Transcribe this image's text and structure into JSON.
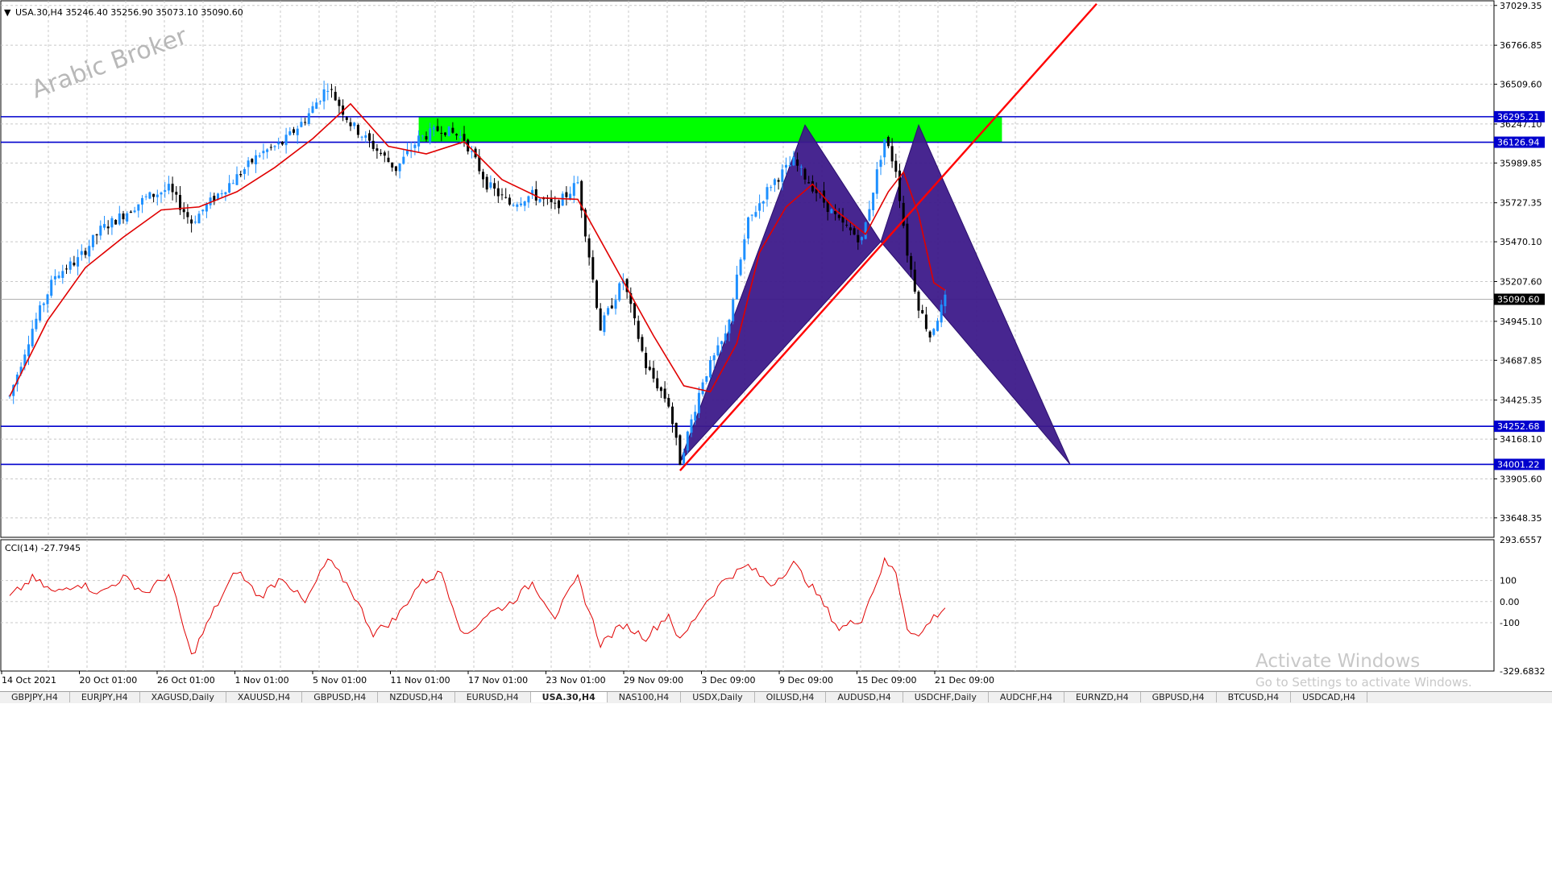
{
  "header": {
    "symbol_info": "USA.30,H4  35246.40 35256.90 35073.10 35090.60",
    "menu_icon": "triangle-down-icon"
  },
  "watermark": "Arabic Broker",
  "price_axis": {
    "ticks": [
      37029.35,
      36766.85,
      36509.6,
      36247.1,
      35989.85,
      35727.35,
      35470.1,
      35207.6,
      34945.1,
      34687.85,
      34425.35,
      34168.1,
      33905.6,
      33648.35
    ],
    "current_price": "35090.60"
  },
  "levels": [
    {
      "value": 36295.21,
      "label": "36295.21"
    },
    {
      "value": 36126.94,
      "label": "36126.94"
    },
    {
      "value": 34252.68,
      "label": "34252.68"
    },
    {
      "value": 34001.22,
      "label": "34001.22"
    }
  ],
  "colors": {
    "level_line": "#0000cd",
    "zone": "#00ff00",
    "pattern": "#3d1a8a",
    "trend": "#ff0000",
    "ma": "#e00000",
    "candle_up": "#1e90ff",
    "candle_down": "#000000",
    "cci": "#e00000"
  },
  "cci": {
    "label": "CCI(14) -27.7945",
    "ticks": [
      "293.6557",
      "100",
      "0.00",
      "-100",
      "-329.6832"
    ]
  },
  "time_axis": {
    "labels": [
      "14 Oct 2021",
      "20 Oct 01:00",
      "26 Oct 01:00",
      "1 Nov 01:00",
      "5 Nov 01:00",
      "11 Nov 01:00",
      "17 Nov 01:00",
      "23 Nov 01:00",
      "29 Nov 09:00",
      "3 Dec 09:00",
      "9 Dec 09:00",
      "15 Dec 09:00",
      "21 Dec 09:00"
    ]
  },
  "tabs": [
    "GBPJPY,H4",
    "EURJPY,H4",
    "XAGUSD,Daily",
    "XAUUSD,H4",
    "GBPUSD,H4",
    "NZDUSD,H4",
    "EURUSD,H4",
    "USA.30,H4",
    "NAS100,H4",
    "USDX,Daily",
    "OILUSD,H4",
    "AUDUSD,H4",
    "USDCHF,Daily",
    "AUDCHF,H4",
    "EURNZD,H4",
    "GBPUSD,H4",
    "BTCUSD,H4",
    "USDCAD,H4"
  ],
  "active_tab": 7,
  "activate_windows": {
    "title": "Activate Windows",
    "subtitle": "Go to Settings to activate Windows."
  },
  "chart_data": {
    "type": "candlestick",
    "title": "USA.30,H4",
    "price_range": [
      33520,
      37060
    ],
    "cci_range": [
      -329.6832,
      293.6557
    ],
    "key_prices": {
      "swing_high_oct": 36580,
      "swing_low_nov30": 33980,
      "peak_dec9": 36240,
      "peak_dec16": 36240,
      "point_c": 35470,
      "last_close": 35090.6
    },
    "price_path": [
      [
        0,
        34450
      ],
      [
        6,
        34900
      ],
      [
        12,
        35250
      ],
      [
        18,
        35350
      ],
      [
        24,
        35550
      ],
      [
        30,
        35650
      ],
      [
        36,
        35760
      ],
      [
        42,
        35820
      ],
      [
        48,
        35600
      ],
      [
        54,
        35760
      ],
      [
        60,
        35900
      ],
      [
        66,
        36050
      ],
      [
        72,
        36120
      ],
      [
        78,
        36280
      ],
      [
        84,
        36500
      ],
      [
        90,
        36250
      ],
      [
        96,
        36100
      ],
      [
        102,
        35950
      ],
      [
        108,
        36150
      ],
      [
        114,
        36220
      ],
      [
        120,
        36150
      ],
      [
        126,
        35850
      ],
      [
        132,
        35720
      ],
      [
        138,
        35780
      ],
      [
        144,
        35700
      ],
      [
        150,
        35860
      ],
      [
        156,
        34900
      ],
      [
        162,
        35220
      ],
      [
        168,
        34650
      ],
      [
        174,
        34400
      ],
      [
        177,
        34020
      ],
      [
        183,
        34560
      ],
      [
        189,
        34850
      ],
      [
        195,
        35600
      ],
      [
        201,
        35850
      ],
      [
        207,
        36000
      ],
      [
        213,
        35800
      ],
      [
        219,
        35600
      ],
      [
        225,
        35480
      ],
      [
        231,
        36150
      ],
      [
        234,
        35950
      ],
      [
        237,
        35400
      ],
      [
        240,
        35050
      ],
      [
        243,
        34850
      ],
      [
        247,
        35090.6
      ]
    ],
    "ma_path": [
      [
        0,
        34450
      ],
      [
        10,
        34950
      ],
      [
        20,
        35300
      ],
      [
        30,
        35500
      ],
      [
        40,
        35680
      ],
      [
        50,
        35700
      ],
      [
        60,
        35800
      ],
      [
        70,
        35960
      ],
      [
        80,
        36150
      ],
      [
        90,
        36380
      ],
      [
        100,
        36100
      ],
      [
        110,
        36050
      ],
      [
        120,
        36130
      ],
      [
        130,
        35880
      ],
      [
        140,
        35760
      ],
      [
        150,
        35750
      ],
      [
        160,
        35300
      ],
      [
        170,
        34850
      ],
      [
        178,
        34520
      ],
      [
        185,
        34480
      ],
      [
        192,
        34800
      ],
      [
        198,
        35400
      ],
      [
        205,
        35700
      ],
      [
        212,
        35850
      ],
      [
        218,
        35680
      ],
      [
        226,
        35520
      ],
      [
        232,
        35800
      ],
      [
        236,
        35930
      ],
      [
        240,
        35650
      ],
      [
        244,
        35200
      ],
      [
        247,
        35150
      ]
    ],
    "cci_values": [
      [
        0,
        20
      ],
      [
        6,
        110
      ],
      [
        12,
        40
      ],
      [
        18,
        90
      ],
      [
        24,
        40
      ],
      [
        30,
        115
      ],
      [
        36,
        40
      ],
      [
        42,
        130
      ],
      [
        48,
        -260
      ],
      [
        54,
        -40
      ],
      [
        60,
        150
      ],
      [
        66,
        20
      ],
      [
        72,
        120
      ],
      [
        78,
        -10
      ],
      [
        84,
        200
      ],
      [
        90,
        60
      ],
      [
        96,
        -150
      ],
      [
        102,
        -80
      ],
      [
        108,
        80
      ],
      [
        114,
        140
      ],
      [
        120,
        -170
      ],
      [
        126,
        -60
      ],
      [
        132,
        -10
      ],
      [
        138,
        90
      ],
      [
        144,
        -70
      ],
      [
        150,
        110
      ],
      [
        156,
        -200
      ],
      [
        162,
        -110
      ],
      [
        168,
        -170
      ],
      [
        174,
        -60
      ],
      [
        177,
        -190
      ],
      [
        183,
        -20
      ],
      [
        189,
        110
      ],
      [
        195,
        170
      ],
      [
        201,
        80
      ],
      [
        207,
        180
      ],
      [
        213,
        40
      ],
      [
        219,
        -130
      ],
      [
        225,
        -80
      ],
      [
        231,
        190
      ],
      [
        234,
        140
      ],
      [
        237,
        -120
      ],
      [
        240,
        -170
      ],
      [
        243,
        -90
      ],
      [
        247,
        -27.79
      ]
    ],
    "harmonic_pattern": {
      "X": [
        177,
        34020
      ],
      "A": [
        210,
        36240
      ],
      "B": [
        230,
        35470
      ],
      "C": [
        240,
        36240
      ],
      "D": [
        280,
        34001.22
      ]
    },
    "trendline": {
      "from": [
        177,
        33960
      ],
      "to": [
        287,
        37040
      ]
    },
    "zone": {
      "from_bar": 108,
      "to_bar": 262,
      "top": 36295.21,
      "bottom": 36126.94
    }
  }
}
